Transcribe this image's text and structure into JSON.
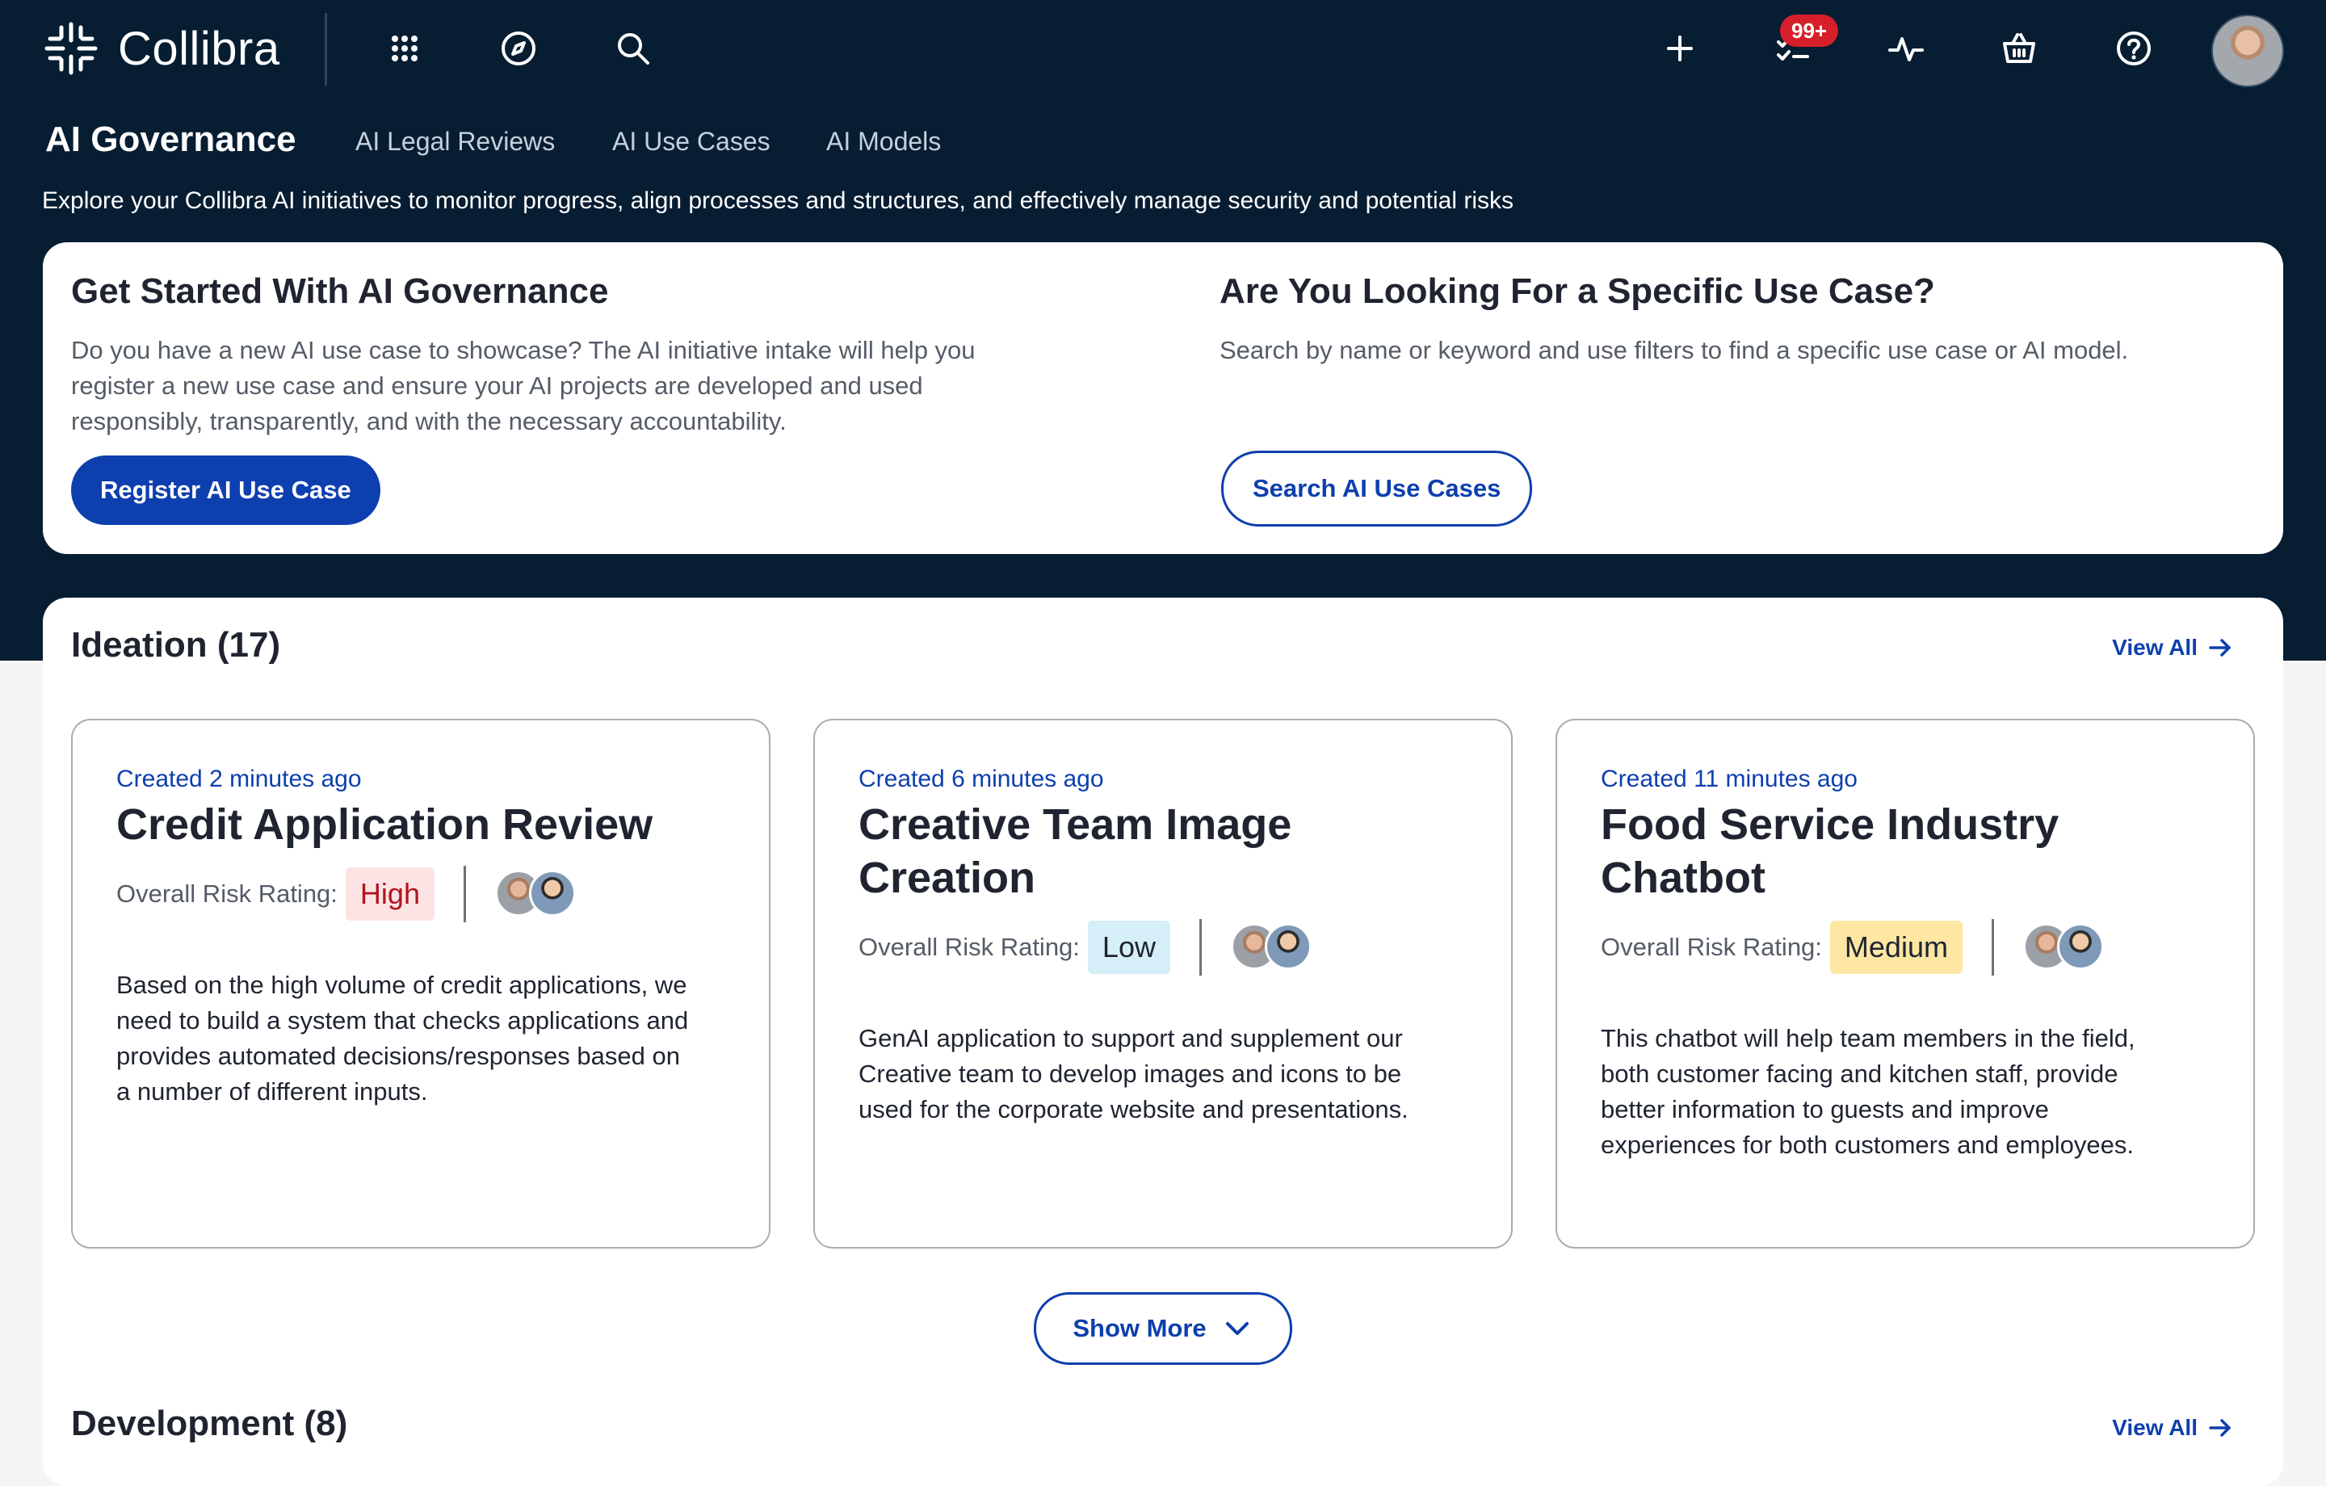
{
  "app": {
    "name": "Collibra"
  },
  "topbar": {
    "notifications_badge": "99+",
    "icons": [
      "apps-grid-icon",
      "compass-icon",
      "search-icon",
      "plus-icon",
      "tasks-icon",
      "activity-icon",
      "basket-icon",
      "help-icon"
    ]
  },
  "module": {
    "title": "AI Governance",
    "tabs": [
      "AI Legal Reviews",
      "AI Use Cases",
      "AI Models"
    ],
    "intro": "Explore your Collibra AI initiatives to monitor progress, align processes and structures, and effectively manage security and potential risks"
  },
  "get_started": {
    "title": "Get Started With AI Governance",
    "text_lines": [
      "Do you have a new AI use case to showcase? The AI initiative intake will help you",
      "register a new use case and ensure your AI projects are developed and used",
      "responsibly, transparently, and with the necessary accountability."
    ],
    "button": "Register AI Use Case"
  },
  "search_card": {
    "title": "Are You Looking For a Specific Use Case?",
    "text": "Search by name or keyword and use filters to find a specific use case or AI model.",
    "button": "Search AI Use Cases"
  },
  "ideation": {
    "title": "Ideation (17)",
    "view_all": "View All",
    "show_more": "Show More",
    "risk_label": "Overall Risk Rating:",
    "cards": [
      {
        "created": "Created 2 minutes ago",
        "title_lines": [
          "Credit Application Review"
        ],
        "risk": "High",
        "desc_lines": [
          "Based on the high volume of credit applications, we",
          "need to build a system that checks applications and",
          "provides automated decisions/responses based on",
          "a number of different inputs."
        ]
      },
      {
        "created": "Created 6 minutes ago",
        "title_lines": [
          "Creative Team Image",
          "Creation"
        ],
        "risk": "Low",
        "desc_lines": [
          "GenAI application to support and supplement our",
          "Creative team to develop images and icons to be",
          "used for the corporate website and presentations."
        ]
      },
      {
        "created": "Created 11 minutes ago",
        "title_lines": [
          "Food Service Industry",
          "Chatbot"
        ],
        "risk": "Medium",
        "desc_lines": [
          "This chatbot will help team members in the field,",
          "both customer facing and kitchen staff, provide",
          "better information to guests and improve",
          "experiences for both customers and employees."
        ]
      }
    ]
  },
  "development": {
    "title": "Development (8)",
    "view_all": "View All"
  },
  "colors": {
    "hero_bg": "#071d32",
    "accent": "#0d3fae",
    "risk_high_bg": "#fde4e4",
    "risk_high_text": "#b3141f",
    "risk_low_bg": "#d5eef7",
    "risk_medium_bg": "#fde7a3"
  }
}
